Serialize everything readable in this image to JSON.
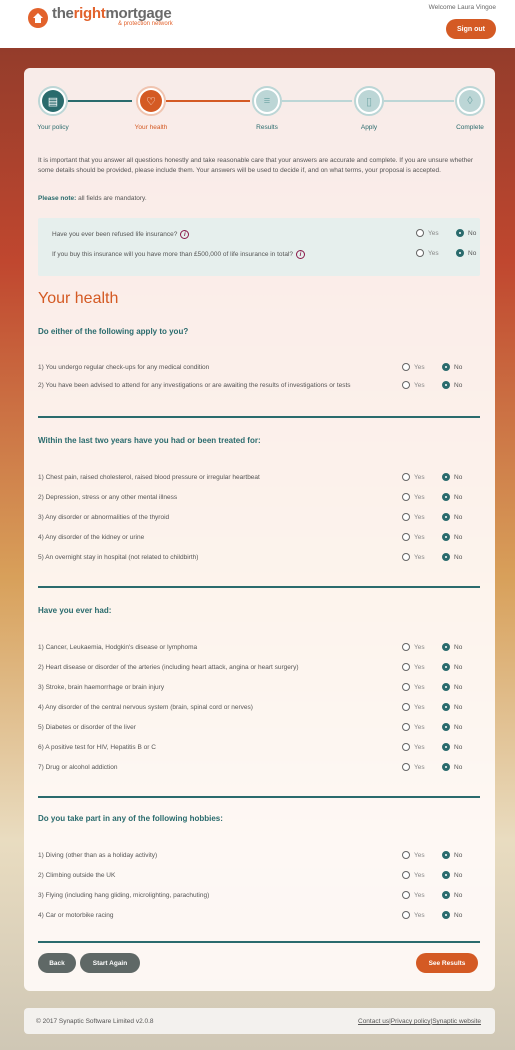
{
  "header": {
    "logo_part1": "the",
    "logo_part2": "right",
    "logo_part3": "mortgage",
    "logo_sub": "& protection network",
    "welcome": "Welcome Laura Vingoe",
    "signout_label": "Sign out"
  },
  "steps": [
    {
      "label": "Your policy",
      "icon": "document-icon",
      "state": "done"
    },
    {
      "label": "Your health",
      "icon": "heart-icon",
      "state": "active"
    },
    {
      "label": "Results",
      "icon": "list-icon",
      "state": "pending"
    },
    {
      "label": "Apply",
      "icon": "form-icon",
      "state": "pending"
    },
    {
      "label": "Complete",
      "icon": "shield-icon",
      "state": "pending"
    }
  ],
  "intro": "It is important that you answer all questions honestly and take reasonable care that your answers are accurate and complete. If you are unsure whether some details should be provided, please include them. Your answers will be used to decide if, and on what terms, your proposal is accepted.",
  "note_label": "Please note:",
  "note_text": "all fields are mandatory.",
  "radio_yes": "Yes",
  "radio_no": "No",
  "pre_questions": [
    {
      "text": "Have you ever been refused life insurance?",
      "answer": "No",
      "info": "i"
    },
    {
      "text": "If you buy this insurance will you have more than £500,000 of life insurance in total?",
      "answer": "No",
      "info": "i"
    }
  ],
  "section_title": "Your health",
  "groups": [
    {
      "title": "Do either of the following apply to you?",
      "questions": [
        {
          "text": "1) You undergo regular check-ups for any medical condition",
          "answer": "No"
        },
        {
          "text": "2) You have been advised to attend for any investigations or are awaiting the results of investigations or tests",
          "answer": "No"
        }
      ]
    },
    {
      "title": "Within the last two years have you had or been treated for:",
      "questions": [
        {
          "text": "1) Chest pain, raised cholesterol, raised blood pressure or irregular heartbeat",
          "answer": "No"
        },
        {
          "text": "2) Depression, stress or any other mental illness",
          "answer": "No"
        },
        {
          "text": "3) Any disorder or abnormalities of the thyroid",
          "answer": "No"
        },
        {
          "text": "4) Any disorder of the kidney or urine",
          "answer": "No"
        },
        {
          "text": "5) An overnight stay in hospital (not related to childbirth)",
          "answer": "No"
        }
      ]
    },
    {
      "title": "Have you ever had:",
      "questions": [
        {
          "text": "1) Cancer, Leukaemia, Hodgkin's disease or lymphoma",
          "answer": "No"
        },
        {
          "text": "2) Heart disease or disorder of the arteries (including heart attack, angina or heart surgery)",
          "answer": "No"
        },
        {
          "text": "3) Stroke, brain haemorrhage or brain injury",
          "answer": "No"
        },
        {
          "text": "4) Any disorder of the central nervous system (brain, spinal cord or nerves)",
          "answer": "No"
        },
        {
          "text": "5) Diabetes or disorder of the liver",
          "answer": "No"
        },
        {
          "text": "6) A positive test for HIV, Hepatitis B or C",
          "answer": "No"
        },
        {
          "text": "7) Drug or alcohol addiction",
          "answer": "No"
        }
      ]
    },
    {
      "title": "Do you take part in any of the following hobbies:",
      "questions": [
        {
          "text": "1) Diving (other than as a holiday activity)",
          "answer": "No"
        },
        {
          "text": "2) Climbing outside the UK",
          "answer": "No"
        },
        {
          "text": "3) Flying (including hang gliding, microlighting, parachuting)",
          "answer": "No"
        },
        {
          "text": "4) Car or motorbike racing",
          "answer": "No"
        }
      ]
    }
  ],
  "buttons": {
    "back": "Back",
    "start_again": "Start Again",
    "see_results": "See Results"
  },
  "footer": {
    "copyright": "© 2017 Synaptic Software Limited v2.0.8",
    "contact": "Contact us",
    "privacy": "Privacy policy",
    "website": "Synaptic website",
    "separator": "|"
  },
  "colors": {
    "accent": "#d45a24",
    "teal": "#2a6b6d"
  }
}
